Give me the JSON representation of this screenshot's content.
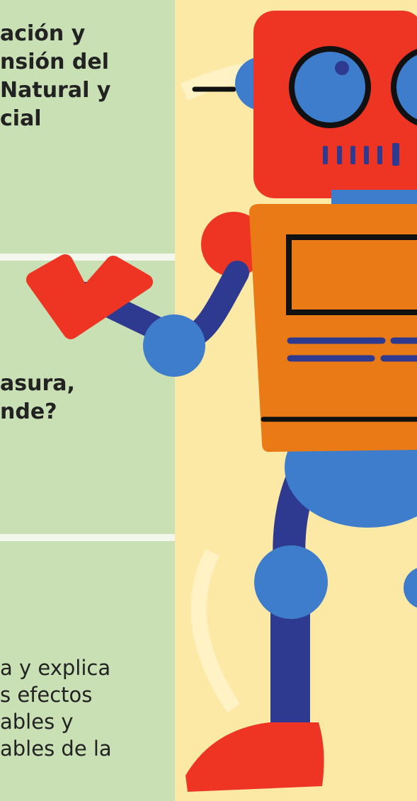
{
  "sections": [
    {
      "lines": [
        "ación y",
        "nsión del",
        " Natural y",
        "cial"
      ]
    },
    {
      "lines": [
        "asura,",
        "nde?"
      ]
    },
    {
      "lines": [
        "a y explica",
        "s efectos",
        "ables y",
        "ables de la"
      ]
    }
  ],
  "colors": {
    "panel_green": "#c9e0b4",
    "background_yellow": "#fde9a6",
    "robot_head": "#ee3524",
    "robot_body": "#e97a16",
    "robot_limbs": "#2e3a8f",
    "robot_joints": "#3d7dcb",
    "arrow": "#ee3524"
  },
  "icons": [
    "robot-illustration",
    "check-arrow-icon"
  ]
}
